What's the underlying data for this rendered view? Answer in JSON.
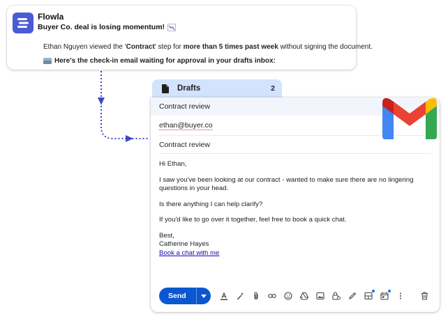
{
  "notification": {
    "app_name": "Flowla",
    "headline": "Buyer Co. deal is losing momentum!",
    "line1": {
      "name": "Ethan Nguyen",
      "text_a": " viewed the '",
      "step": "Contract",
      "text_b": "' step for ",
      "duration": "more than 5 times past week",
      "text_c": " without signing the document."
    },
    "line2": "Here's the check-in email waiting for approval in your drafts inbox:"
  },
  "drafts": {
    "label": "Drafts",
    "count": "2"
  },
  "compose": {
    "subject_bar": "Contract review",
    "to": "ethan@buyer.co",
    "subject": "Contract review",
    "body": {
      "greeting": "Hi Ethan,",
      "p1": "I saw you've been looking at our contract - wanted to make sure there are no lingering questions in your head.",
      "p2": "Is there anything I can help clarify?",
      "p3": "If you'd like to go over it together, feel free to book a quick chat.",
      "signoff": "Best,",
      "signature": "Catherine Hayes",
      "link": "Book a chat with me"
    },
    "toolbar": {
      "send_label": "Send"
    }
  },
  "colors": {
    "flowla_brand": "#4a5bd6",
    "send_button": "#0b57d0",
    "drafts_tab": "#d3e3fd",
    "connector": "#3b48cc"
  }
}
